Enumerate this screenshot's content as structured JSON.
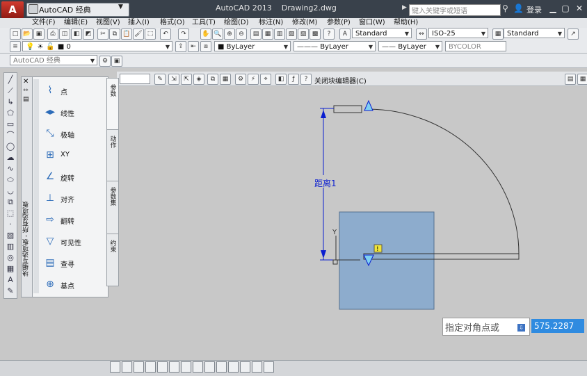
{
  "titlebar": {
    "workspace": "AutoCAD 经典",
    "app_name": "AutoCAD 2013",
    "document": "Drawing2.dwg",
    "search_placeholder": "键入关键字或短语",
    "login": "登录"
  },
  "menu": [
    "文件(F)",
    "编辑(E)",
    "视图(V)",
    "插入(I)",
    "格式(O)",
    "工具(T)",
    "绘图(D)",
    "标注(N)",
    "修改(M)",
    "参数(P)",
    "窗口(W)",
    "帮助(H)"
  ],
  "styles_toolbar": {
    "text_style": "Standard",
    "dim_style": "ISO-25",
    "table_style": "Standard"
  },
  "layers_toolbar": {
    "layer": "0",
    "color": "ByLayer",
    "linetype": "ByLayer",
    "lineweight": "ByLayer",
    "plotstyle": "BYCOLOR"
  },
  "workspace_combo": "AutoCAD 经典",
  "block_editor": {
    "close_label": "关闭块编辑器(C)"
  },
  "palette": {
    "title": "块编写选项板 - 所有选项板",
    "items": [
      {
        "label": "点",
        "icon": "point-param-icon"
      },
      {
        "label": "线性",
        "icon": "linear-param-icon"
      },
      {
        "label": "极轴",
        "icon": "polar-param-icon"
      },
      {
        "label": "XY",
        "icon": "xy-param-icon"
      },
      {
        "label": "旋转",
        "icon": "rotation-param-icon"
      },
      {
        "label": "对齐",
        "icon": "alignment-param-icon"
      },
      {
        "label": "翻转",
        "icon": "flip-param-icon"
      },
      {
        "label": "可见性",
        "icon": "visibility-param-icon"
      },
      {
        "label": "查寻",
        "icon": "lookup-param-icon"
      },
      {
        "label": "基点",
        "icon": "basepoint-param-icon"
      }
    ],
    "tabs": [
      "参数",
      "动作",
      "参数集",
      "约束"
    ]
  },
  "drawing": {
    "dimension_label": "距离1",
    "warning_badge": "!"
  },
  "command": {
    "prompt": "指定对角点或",
    "value": "575.2287"
  },
  "colors": {
    "accent": "#2f8be0",
    "title_bg": "#39414b",
    "rect_fill": "#8daccd",
    "param_blue": "#0a1ed0"
  }
}
